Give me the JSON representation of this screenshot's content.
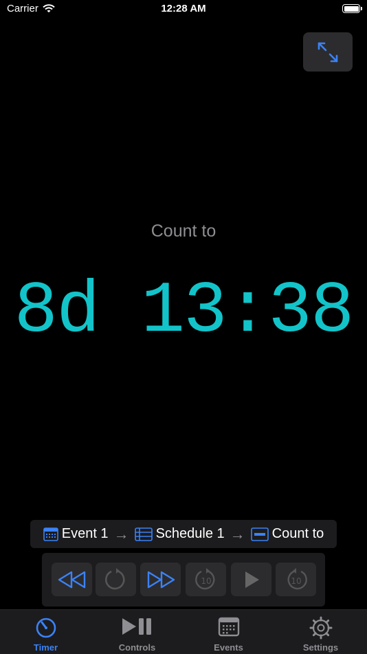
{
  "status": {
    "carrier": "Carrier",
    "time": "12:28 AM"
  },
  "timer": {
    "label": "Count to",
    "value": "8d 13:38"
  },
  "breadcrumb": {
    "event": "Event 1",
    "schedule": "Schedule 1",
    "mode": "Count to"
  },
  "controls": {
    "rewind": "rewind-icon",
    "reset": "reset-icon",
    "forward": "fast-forward-icon",
    "back10": "10",
    "play": "play-icon",
    "fwd10": "10"
  },
  "tabs": [
    {
      "label": "Timer"
    },
    {
      "label": "Controls"
    },
    {
      "label": "Events"
    },
    {
      "label": "Settings"
    }
  ],
  "colors": {
    "accent": "#3b82f6",
    "timer": "#12c4c9",
    "inactive": "#8e8e93"
  }
}
